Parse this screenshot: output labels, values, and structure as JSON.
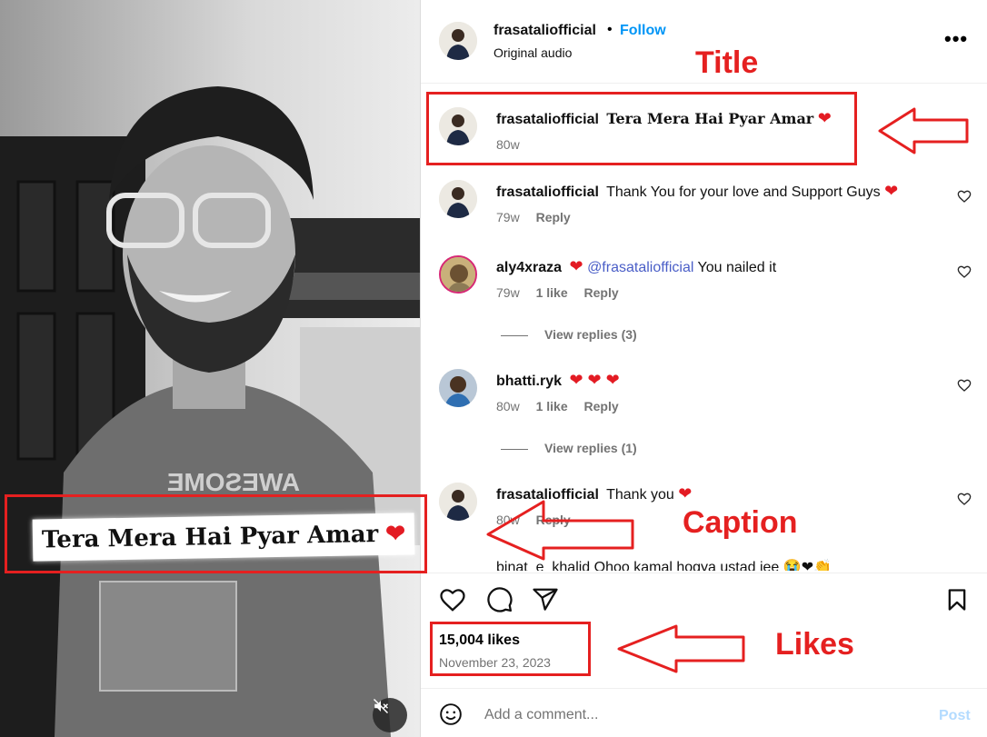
{
  "post": {
    "username": "frasataliofficial",
    "follow_label": "Follow",
    "dot": "•",
    "audio": "Original audio",
    "more_label": "•••",
    "video_caption": "Tera Mera Hai Pyar Amar",
    "caption_heart": "❤"
  },
  "comments": [
    {
      "user": "frasataliofficial",
      "text": "Tera Mera Hai Pyar Amar",
      "emoji": "❤",
      "age": "80w"
    },
    {
      "user": "frasataliofficial",
      "text": "Thank You for your love and Support Guys",
      "emoji": "❤",
      "age": "79w",
      "reply": "Reply"
    },
    {
      "user": "aly4xraza",
      "emoji_pre": "❤",
      "mention": "@frasataliofficial",
      "text": "You nailed it",
      "age": "79w",
      "likes": "1 like",
      "reply": "Reply",
      "view_replies": "View replies (3)"
    },
    {
      "user": "bhatti.ryk",
      "emoji": "❤ ❤ ❤",
      "age": "80w",
      "likes": "1 like",
      "reply": "Reply",
      "view_replies": "View replies (1)"
    },
    {
      "user": "frasataliofficial",
      "text": "Thank you",
      "emoji": "❤",
      "age": "80w",
      "reply": "Reply"
    },
    {
      "partial": "binat_e_khalid Ohoo kamal hogya ustad jee 😭❤👏"
    }
  ],
  "stats": {
    "likes": "15,004 likes",
    "date": "November 23, 2023"
  },
  "comment_box": {
    "placeholder": "Add a comment...",
    "post_label": "Post"
  },
  "annotations": {
    "title": "Title",
    "caption": "Caption",
    "likes": "Likes"
  },
  "colors": {
    "follow": "#0095f6",
    "annotation": "#e52020",
    "heart": "#e31b23",
    "mention": "#4a5ec7"
  }
}
